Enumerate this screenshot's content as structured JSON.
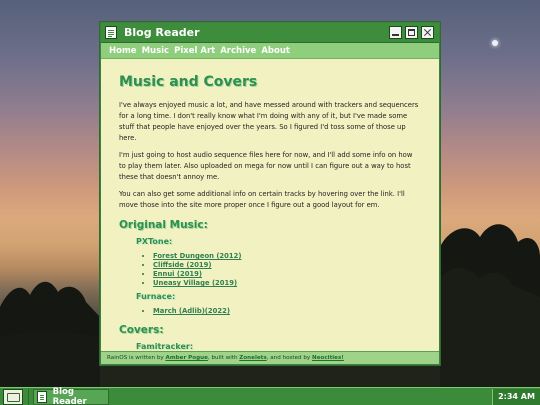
{
  "window": {
    "title": "Blog Reader",
    "nav": [
      "Home",
      "Music",
      "Pixel Art",
      "Archive",
      "About"
    ]
  },
  "page": {
    "title": "Music and Covers",
    "paragraphs": [
      "I've always enjoyed music a lot, and have messed around with trackers and sequencers for a long time. I don't really know what I'm doing with any of it, but I've made some stuff that people have enjoyed over the years. So I figured I'd toss some of those up here.",
      "I'm just going to host audio sequence files here for now, and I'll add some info on how to play them later. Also uploaded on mega for now until I can figure out a way to host these that doesn't annoy me.",
      "You can also get some additional info on certain tracks by hovering over the link. I'll move those into the site more proper once I figure out a good layout for em."
    ],
    "original_music": {
      "title": "Original Music:",
      "groups": [
        {
          "name": "PXTone:",
          "tracks": [
            "Forest Dungeon (2012)",
            "Cliffside (2019)",
            "Ennui (2019)",
            "Uneasy Village (2019)"
          ]
        },
        {
          "name": "Furnace:",
          "tracks": [
            "March (Adlib)(2022)"
          ]
        }
      ]
    },
    "covers": {
      "title": "Covers:",
      "groups": [
        {
          "name": "Famitracker:"
        }
      ]
    }
  },
  "status": {
    "prefix": "RainOS is written by ",
    "author": "Amber Pogue",
    "mid1": ", built with ",
    "tool": "Zonelets",
    "mid2": ", and hosted by ",
    "host": "Neocities!"
  },
  "taskbar": {
    "item_label": "Blog Reader",
    "clock": "2:34 AM"
  },
  "colors": {
    "window_green": "#3d8d3d",
    "nav_green": "#8fce7c",
    "content_bg": "#f1f1c2",
    "heading_green": "#2f8f4f"
  }
}
